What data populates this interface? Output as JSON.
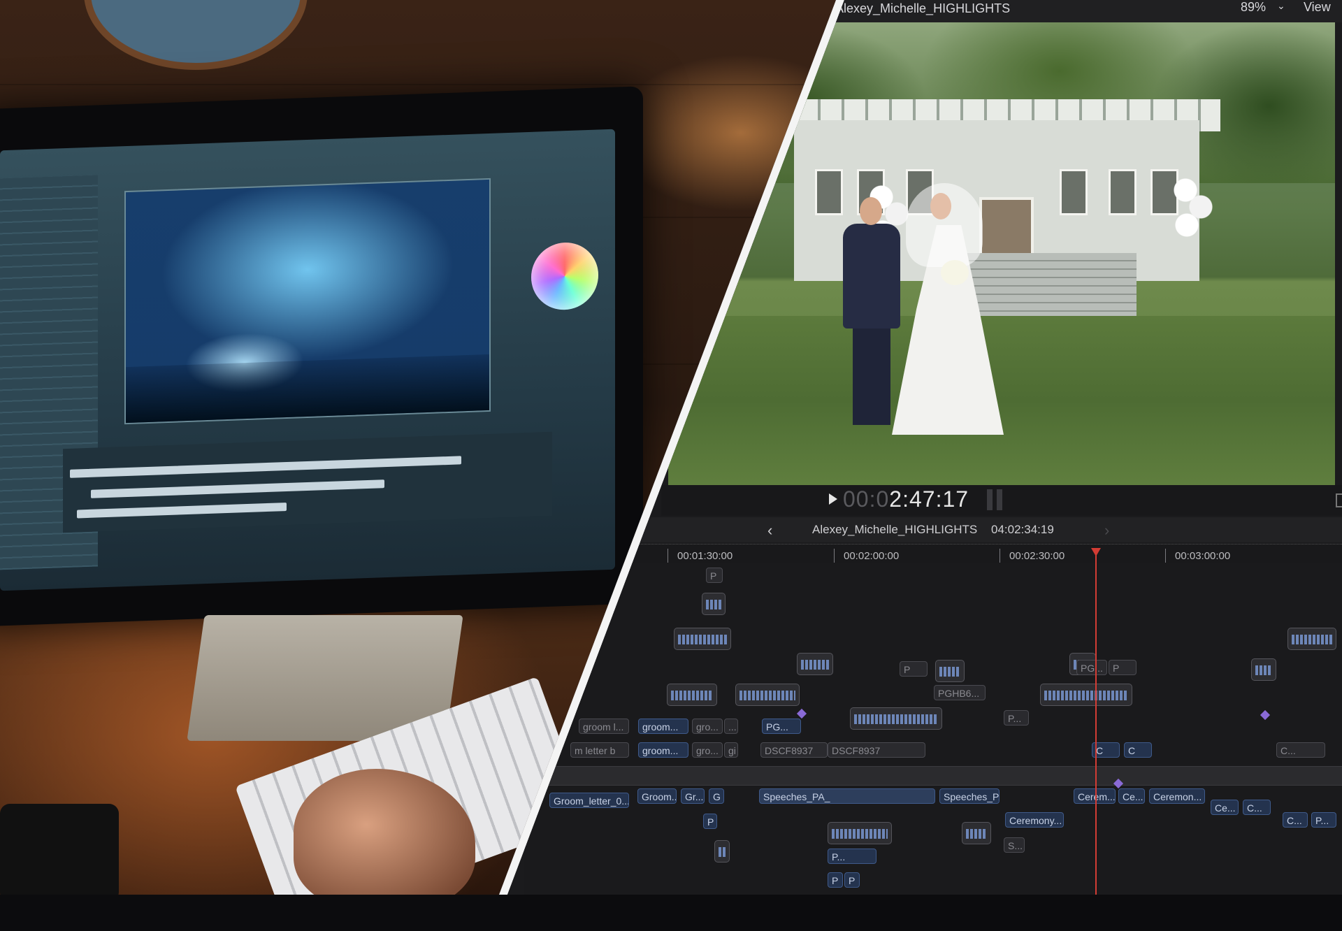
{
  "viewer": {
    "title": "Alexey_Michelle_HIGHLIGHTS",
    "zoom": "89%",
    "view_menu": "View"
  },
  "transport": {
    "timecode_dim": "00:0",
    "timecode_main": "2:47:17"
  },
  "timeline_header": {
    "project_name": "Alexey_Michelle_HIGHLIGHTS",
    "duration": "04:02:34:19"
  },
  "ruler": {
    "labels": [
      "00:01:30:00",
      "00:02:00:00",
      "00:02:30:00",
      "00:03:00:00"
    ]
  },
  "clips": {
    "p1": "P",
    "groom_l": "groom l...",
    "groom_1": "groom...",
    "gro_1": "gro...",
    "ellipsis_1": "...",
    "pg_1": "PG...",
    "groom_letter_b": "m letter b",
    "groom_2": "groom...",
    "gro_2": "gro...",
    "gi": "gi",
    "dscf_1": "DSCF8937",
    "dscf_2": "DSCF8937",
    "pghb6": "PGHB6...",
    "pg_2": "PG...",
    "p_2": "P",
    "p_3": "P",
    "p_4": "P...",
    "c_1": "C",
    "c_2": "C",
    "c_dots": "C...",
    "groom_letter_0": "Groom_letter_0...",
    "groom_cap": "Groom...",
    "gr": "Gr...",
    "g": "G",
    "speeches_pa": "Speeches_PA_",
    "speeches_p": "Speeches_P...",
    "cerem": "Cerem...",
    "ce_1": "Ce...",
    "ceremon": "Ceremon...",
    "ce_2": "Ce...",
    "c_3": "C...",
    "ceremony": "Ceremony...",
    "c_4": "C...",
    "p_5": "P...",
    "s": "S...",
    "p_6": "P",
    "p_7": "P...",
    "p_8": "P",
    "p_9": "P"
  }
}
